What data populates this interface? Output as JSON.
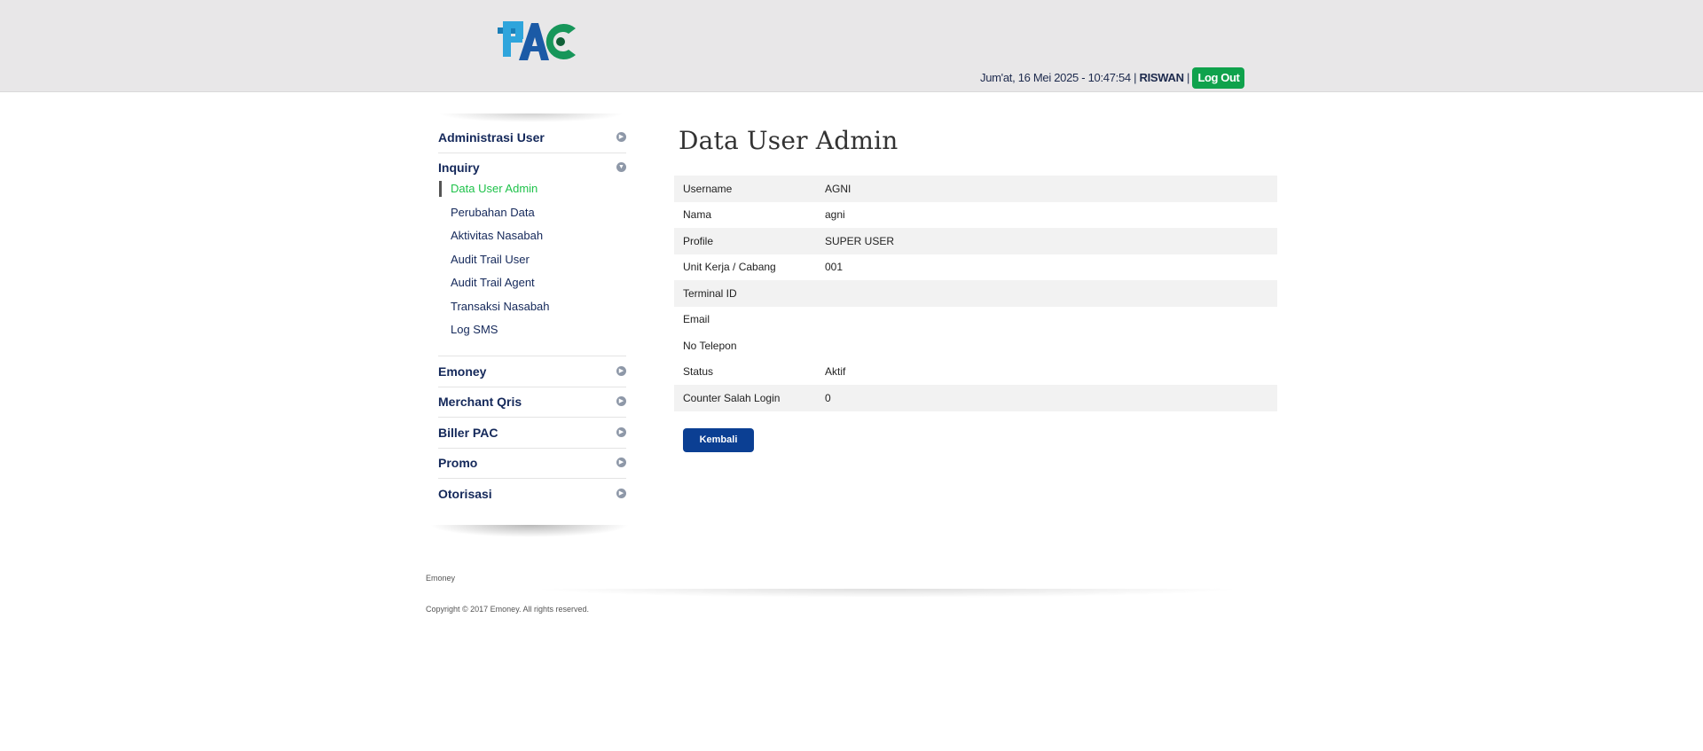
{
  "header": {
    "logo_text": "PAC",
    "datetime": "Jum'at, 16 Mei 2025 - 10:47:54",
    "separator": "|",
    "username": "RISWAN",
    "logout_label": "Log Out",
    "logout_color": "#0fa24c"
  },
  "sidebar": {
    "sections": [
      {
        "label": "Administrasi User",
        "icon": "chevron-right-icon"
      },
      {
        "label": "Inquiry",
        "icon": "chevron-down-icon"
      },
      {
        "label": "Emoney",
        "icon": "chevron-right-icon"
      },
      {
        "label": "Merchant Qris",
        "icon": "chevron-right-icon"
      },
      {
        "label": "Biller PAC",
        "icon": "chevron-right-icon"
      },
      {
        "label": "Promo",
        "icon": "chevron-right-icon"
      },
      {
        "label": "Otorisasi",
        "icon": "chevron-right-icon"
      }
    ],
    "inquiry_items": [
      {
        "label": "Data User Admin",
        "active": true
      },
      {
        "label": "Perubahan Data"
      },
      {
        "label": "Aktivitas Nasabah"
      },
      {
        "label": "Audit Trail User"
      },
      {
        "label": "Audit Trail Agent"
      },
      {
        "label": "Transaksi Nasabah"
      },
      {
        "label": "Log SMS"
      }
    ],
    "active_color": "#1ec24a"
  },
  "main": {
    "title": "Data User Admin",
    "rows": [
      {
        "label": "Username",
        "value": "AGNI"
      },
      {
        "label": "Nama",
        "value": "agni"
      },
      {
        "label": "Profile",
        "value": "SUPER USER"
      },
      {
        "label": "Unit Kerja / Cabang",
        "value": "001"
      },
      {
        "label": "Terminal ID",
        "value": ""
      },
      {
        "label": "Email",
        "value": ""
      },
      {
        "label": "No Telepon",
        "value": ""
      },
      {
        "label": "Status",
        "value": "Aktif"
      },
      {
        "label": "Counter Salah Login",
        "value": "0"
      }
    ],
    "back_button": "Kembali",
    "back_button_color": "#0b3f93"
  },
  "footer": {
    "app_name": "Emoney",
    "copyright": "Copyright © 2017 Emoney. All rights reserved."
  }
}
